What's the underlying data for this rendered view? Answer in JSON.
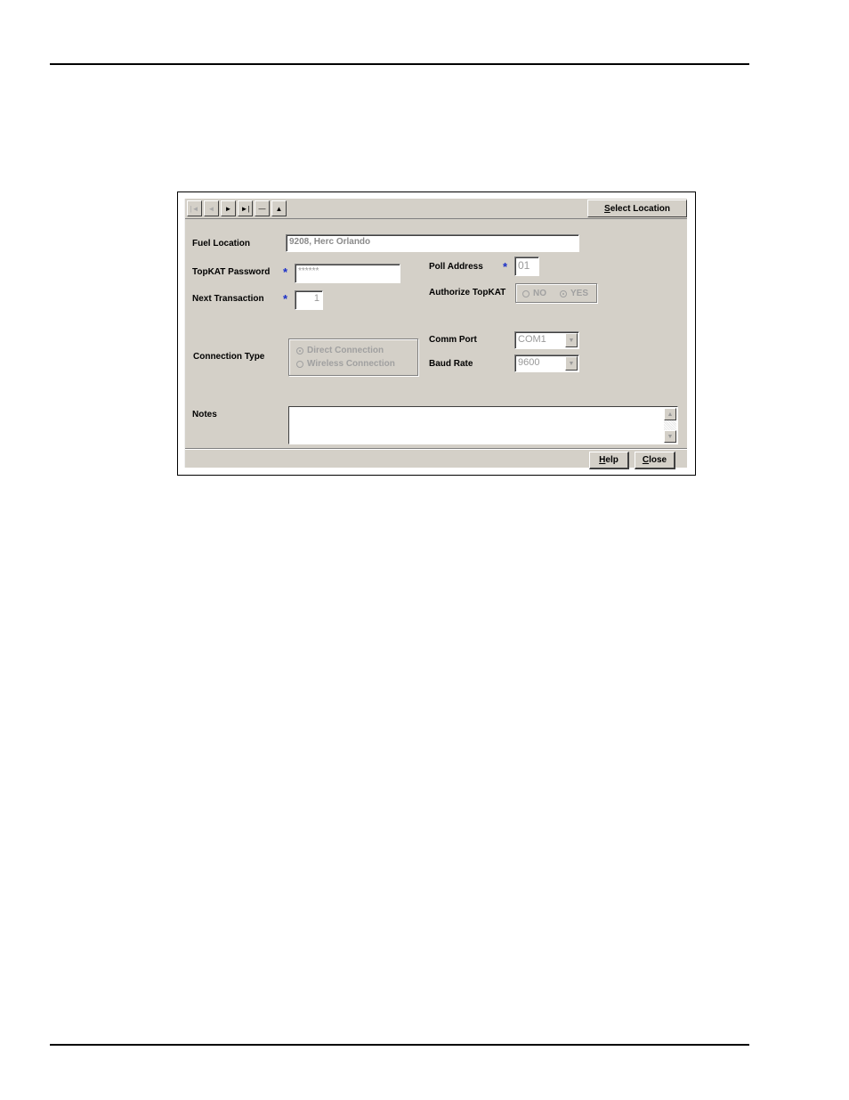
{
  "page": {
    "top_rule": true,
    "bottom_rule": true
  },
  "toolbar": {
    "nav_buttons": [
      {
        "name": "first-record",
        "glyph": "|◄",
        "enabled": false
      },
      {
        "name": "previous-record",
        "glyph": "◄",
        "enabled": false
      },
      {
        "name": "next-record",
        "glyph": "►",
        "enabled": true
      },
      {
        "name": "last-record",
        "glyph": "►|",
        "enabled": true
      },
      {
        "name": "delete-record",
        "glyph": "—",
        "enabled": true
      },
      {
        "name": "collapse",
        "glyph": "▲",
        "enabled": true
      }
    ],
    "select_location": {
      "mnemonic": "S",
      "rest": "elect Location"
    }
  },
  "form": {
    "fuel_location": {
      "label": "Fuel Location",
      "value": "9208, Herc Orlando"
    },
    "topkat_password": {
      "label": "TopKAT Password",
      "value": "******",
      "required": "*"
    },
    "next_transaction": {
      "label": "Next Transaction",
      "value": "1",
      "required": "*"
    },
    "poll_address": {
      "label": "Poll Address",
      "value": "01",
      "required": "*"
    },
    "authorize_topkat": {
      "label": "Authorize TopKAT",
      "options": [
        {
          "label": "NO",
          "selected": false
        },
        {
          "label": "YES",
          "selected": true
        }
      ]
    },
    "connection_type": {
      "label": "Connection Type",
      "options": [
        {
          "label": "Direct Connection",
          "selected": true
        },
        {
          "label": "Wireless Connection",
          "selected": false
        }
      ]
    },
    "comm_port": {
      "label": "Comm Port",
      "value": "COM1"
    },
    "baud_rate": {
      "label": "Baud Rate",
      "value": "9600"
    },
    "notes": {
      "label": "Notes",
      "value": ""
    }
  },
  "footer": {
    "help": {
      "mnemonic": "H",
      "rest": "elp"
    },
    "close": {
      "mnemonic": "C",
      "rest": "lose"
    }
  },
  "colors": {
    "required_star": "#1a2fc8",
    "window_bg": "#d4d0c8"
  }
}
